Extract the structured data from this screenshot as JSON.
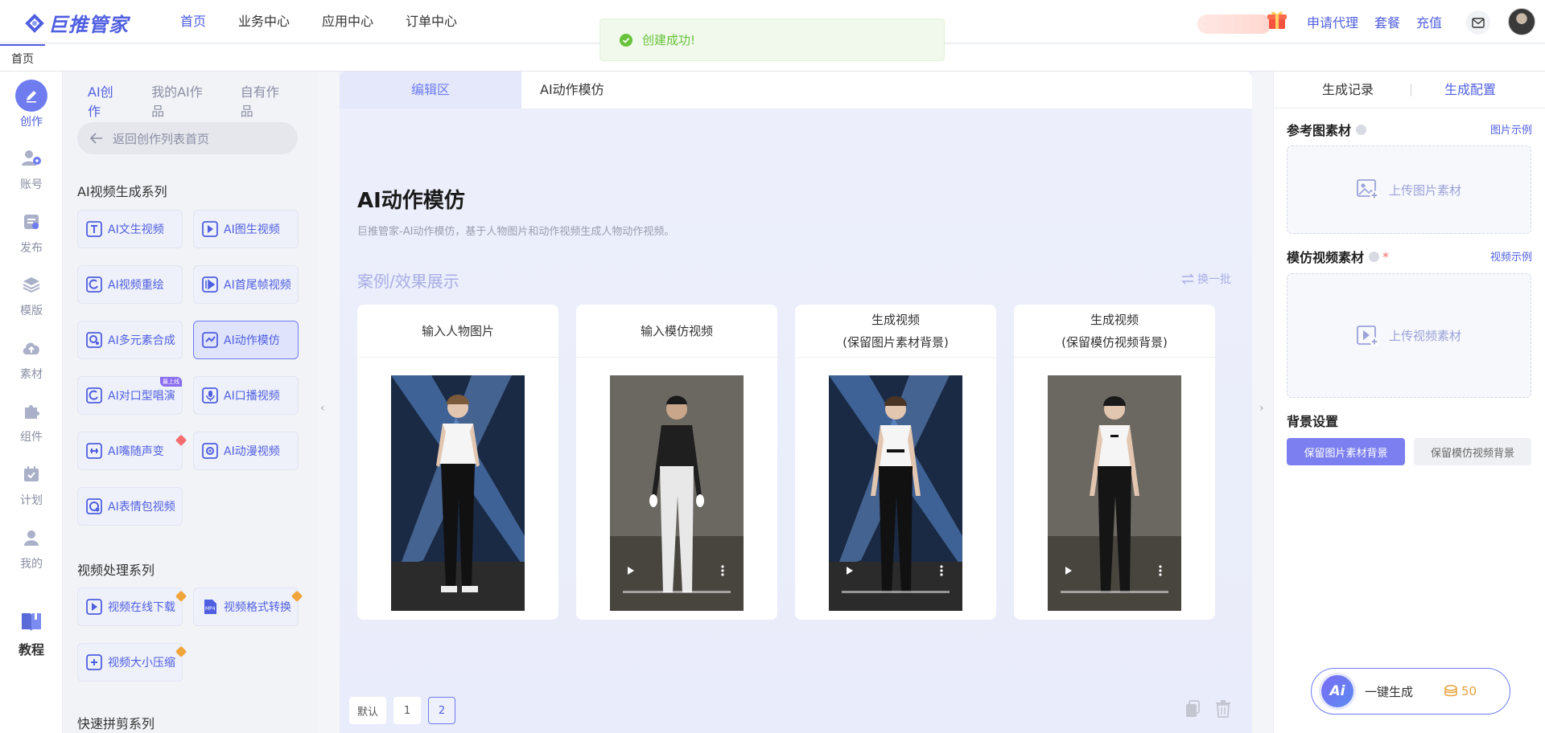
{
  "header": {
    "logo_text": "巨推管家",
    "nav": [
      "首页",
      "业务中心",
      "应用中心",
      "订单中心"
    ],
    "links": [
      "申请代理",
      "套餐",
      "充值"
    ]
  },
  "toast": {
    "text": "创建成功!"
  },
  "tabs": {
    "home": "首页"
  },
  "left_nav": [
    {
      "label": "创作",
      "icon": "edit-icon"
    },
    {
      "label": "账号",
      "icon": "users-icon"
    },
    {
      "label": "发布",
      "icon": "publish-icon"
    },
    {
      "label": "模版",
      "icon": "layers-icon"
    },
    {
      "label": "素材",
      "icon": "cloud-upload-icon"
    },
    {
      "label": "组件",
      "icon": "puzzle-icon"
    },
    {
      "label": "计划",
      "icon": "calendar-icon"
    },
    {
      "label": "我的",
      "icon": "user-icon"
    },
    {
      "label": "教程",
      "icon": "book-icon"
    }
  ],
  "panel": {
    "tabs": [
      "AI创作",
      "我的AI作品",
      "自有作品"
    ],
    "back": "返回创作列表首页",
    "section1": "AI视频生成系列",
    "tools1": [
      "AI文生视频",
      "AI图生视频",
      "AI视频重绘",
      "AI首尾帧视频",
      "AI多元素合成",
      "AI动作模仿",
      "AI对口型唱演",
      "AI口播视频",
      "AI嘴随声变",
      "AI动漫视频",
      "AI表情包视频"
    ],
    "section2": "视频处理系列",
    "tools2": [
      "视频在线下载",
      "视频格式转换",
      "视频大小压缩"
    ],
    "section3": "快速拼剪系列",
    "badge_new": "最上线"
  },
  "main": {
    "tabs": [
      "编辑区",
      "AI动作模仿"
    ],
    "title": "AI动作模仿",
    "desc": "巨推管家-AI动作模仿，基于人物图片和动作视频生成人物动作视频。",
    "case_title": "案例/效果展示",
    "refresh": "换一批",
    "cards": [
      {
        "line1": "输入人物图片",
        "line2": ""
      },
      {
        "line1": "输入模仿视频",
        "line2": ""
      },
      {
        "line1": "生成视频",
        "line2": "(保留图片素材背景)"
      },
      {
        "line1": "生成视频",
        "line2": "(保留模仿视频背景)"
      }
    ],
    "pager": [
      "默认",
      "1",
      "2"
    ]
  },
  "right": {
    "tabs": [
      "生成记录",
      "生成配置"
    ],
    "ref_title": "参考图素材",
    "ref_link": "图片示例",
    "ref_upload": "上传图片素材",
    "video_title": "模仿视频素材",
    "video_required": "*",
    "video_link": "视频示例",
    "video_upload": "上传视频素材",
    "bg_title": "背景设置",
    "bg_options": [
      "保留图片素材背景",
      "保留模仿视频背景"
    ],
    "generate": "一键生成",
    "ai_text": "Ai",
    "cost": "50"
  },
  "colors": {
    "accent": "#4f5fe0",
    "accent_light": "#6f7cf0",
    "success": "#67c23a"
  }
}
